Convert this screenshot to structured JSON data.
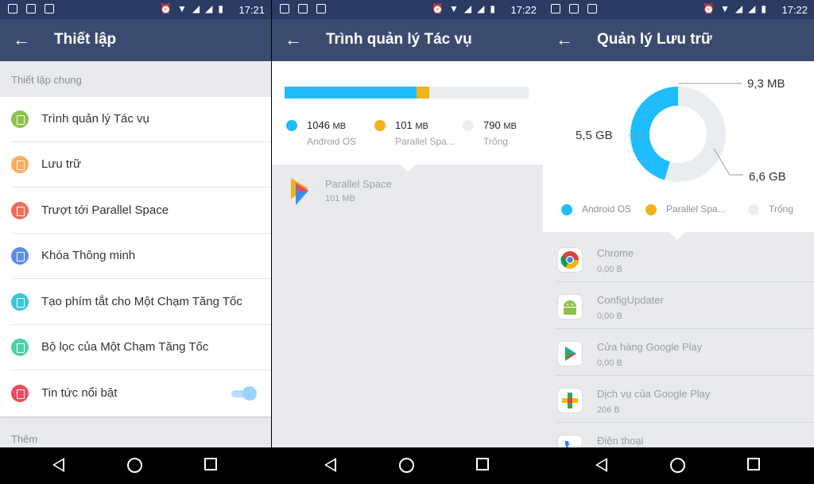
{
  "panels": [
    {
      "time": "17:21",
      "title": "Thiết lập",
      "section1": "Thiết lập chung",
      "section2": "Thêm",
      "items": [
        {
          "label": "Trình quản lý Tác vụ",
          "color": "#8bc34a"
        },
        {
          "label": "Lưu trữ",
          "color": "#ffab5e"
        },
        {
          "label": "Trượt tới Parallel Space",
          "color": "#f26b5b"
        },
        {
          "label": "Khóa Thông minh",
          "color": "#5c8ee6"
        },
        {
          "label": "Tạo phím tắt cho Một Chạm Tăng Tốc",
          "color": "#3cc7d8"
        },
        {
          "label": "Bộ lọc của Một Chạm Tăng Tốc",
          "color": "#4fcfa8"
        },
        {
          "label": "Tin tức nổi bật",
          "color": "#ef4a62"
        }
      ]
    },
    {
      "time": "17:22",
      "title": "Trình quản lý Tác vụ",
      "usage": [
        {
          "value": "1046",
          "unit": "MB",
          "name": "Android OS",
          "color": "#1fbcff",
          "mb": 1046
        },
        {
          "value": "101",
          "unit": "MB",
          "name": "Parallel Spa...",
          "color": "#f2b21b",
          "mb": 101
        },
        {
          "value": "790",
          "unit": "MB",
          "name": "Trống",
          "color": "#eceff2",
          "mb": 790
        }
      ],
      "app": {
        "name": "Parallel Space",
        "size": "101 MB"
      }
    },
    {
      "time": "17:22",
      "title": "Quản lý Lưu trữ",
      "donut_labels": {
        "os": "5,5 GB",
        "ps": "9,3 MB",
        "free": "6,6 GB"
      },
      "donut_values": {
        "os": 5.5,
        "ps": 0.0093,
        "free": 6.6
      },
      "legend": [
        {
          "name": "Android OS",
          "color": "#1fbcff"
        },
        {
          "name": "Parallel Spa...",
          "color": "#f2b21b"
        },
        {
          "name": "Trống",
          "color": "#eceff2"
        }
      ],
      "apps": [
        {
          "name": "Chrome",
          "size": "0,00 B",
          "icon": "chrome-icon"
        },
        {
          "name": "ConfigUpdater",
          "size": "0,00 B",
          "icon": "android-icon"
        },
        {
          "name": "Cửa hàng Google Play",
          "size": "0,00 B",
          "icon": "play-store-icon"
        },
        {
          "name": "Dịch vụ của Google Play",
          "size": "206 B",
          "icon": "play-services-icon"
        },
        {
          "name": "Điện thoại",
          "size": "",
          "icon": "phone-icon"
        }
      ]
    }
  ]
}
